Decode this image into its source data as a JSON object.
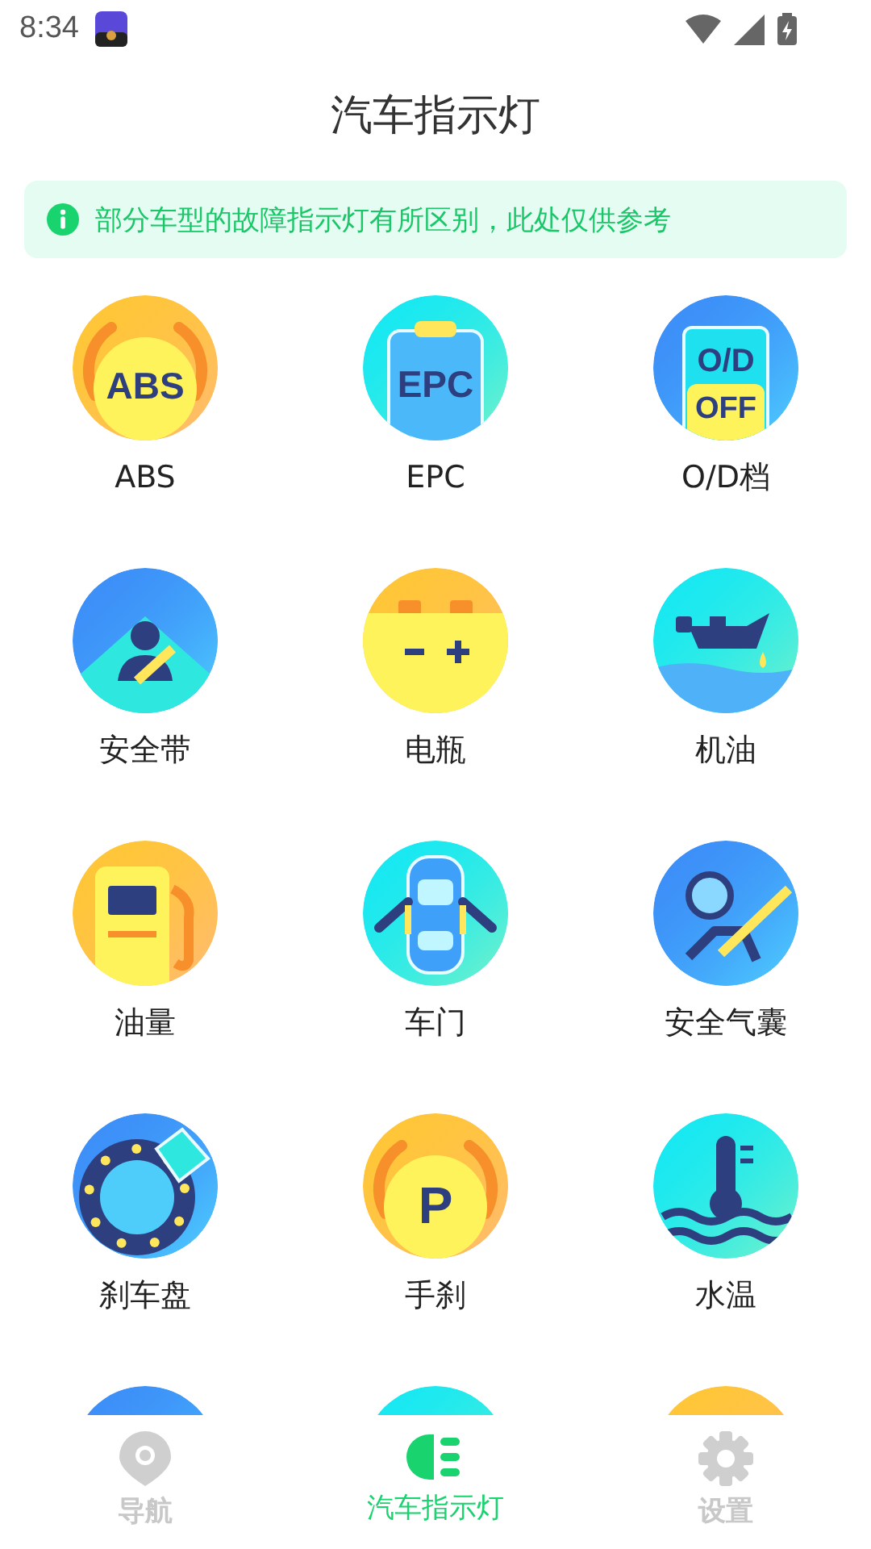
{
  "status_bar": {
    "time": "8:34"
  },
  "header": {
    "title": "汽车指示灯"
  },
  "notice": {
    "text": "部分车型的故障指示灯有所区别，此处仅供参考"
  },
  "items": [
    {
      "kind": "abs",
      "color": "#ffc637",
      "label": "ABS",
      "icon_text": [
        "ABS"
      ]
    },
    {
      "kind": "epc",
      "color": "#16e8f2",
      "label": "EPC",
      "icon_text": [
        "EPC"
      ]
    },
    {
      "kind": "od",
      "color": "#3c8ef8",
      "label": "O/D档",
      "icon_text": [
        "O/D",
        "OFF"
      ]
    },
    {
      "kind": "seatbelt",
      "color": "#3c8ef8",
      "label": "安全带"
    },
    {
      "kind": "battery",
      "color": "#ffc637",
      "label": "电瓶"
    },
    {
      "kind": "oil",
      "color": "#16e8f2",
      "label": "机油"
    },
    {
      "kind": "fuel",
      "color": "#ffc637",
      "label": "油量"
    },
    {
      "kind": "door",
      "color": "#16e8f2",
      "label": "车门"
    },
    {
      "kind": "airbag",
      "color": "#3c8ef8",
      "label": "安全气囊"
    },
    {
      "kind": "brakedisc",
      "color": "#3c8ef8",
      "label": "刹车盘"
    },
    {
      "kind": "parking",
      "color": "#ffc637",
      "label": "手刹",
      "icon_text": [
        "P"
      ]
    },
    {
      "kind": "temperature",
      "color": "#16e8f2",
      "label": "水温"
    },
    {
      "kind": "cut",
      "color": "#3c8ef8"
    },
    {
      "kind": "cut",
      "color": "#16e8f2"
    },
    {
      "kind": "cut",
      "color": "#ffc637"
    }
  ],
  "bottom_nav": [
    {
      "kind": "location",
      "label": "导航",
      "selected": false
    },
    {
      "kind": "headlight",
      "label": "汽车指示灯",
      "selected": true
    },
    {
      "kind": "gear",
      "label": "设置",
      "selected": false
    }
  ]
}
